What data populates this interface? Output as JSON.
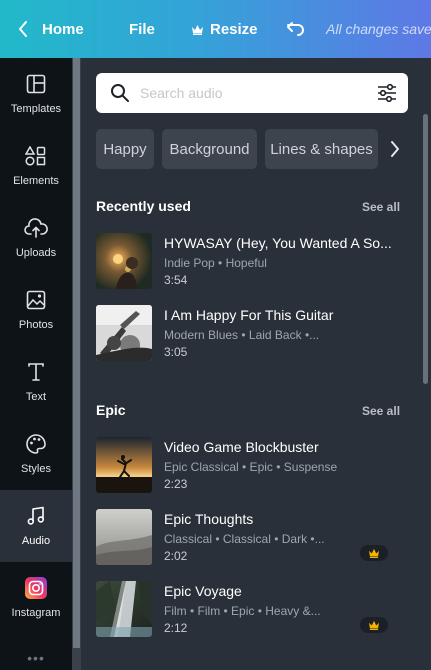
{
  "topbar": {
    "home": "Home",
    "file": "File",
    "resize": "Resize",
    "status": "All changes saved"
  },
  "sidebar": {
    "items": [
      {
        "label": "Templates",
        "icon": "templates-icon"
      },
      {
        "label": "Elements",
        "icon": "elements-icon"
      },
      {
        "label": "Uploads",
        "icon": "upload-cloud-icon"
      },
      {
        "label": "Photos",
        "icon": "photo-icon"
      },
      {
        "label": "Text",
        "icon": "text-icon"
      },
      {
        "label": "Styles",
        "icon": "palette-icon"
      },
      {
        "label": "Audio",
        "icon": "music-note-icon",
        "active": true
      },
      {
        "label": "Instagram",
        "icon": "instagram-icon"
      }
    ],
    "more": "•••"
  },
  "search": {
    "placeholder": "Search audio"
  },
  "chips": [
    "Happy",
    "Background",
    "Lines & shapes"
  ],
  "sections": [
    {
      "title": "Recently used",
      "see_all": "See all",
      "tracks": [
        {
          "title": "HYWASAY (Hey, You Wanted A So...",
          "meta": "Indie Pop • Hopeful",
          "duration": "3:54",
          "premium": false
        },
        {
          "title": "I Am Happy For This Guitar",
          "meta": "Modern Blues • Laid Back •...",
          "duration": "3:05",
          "premium": false
        }
      ]
    },
    {
      "title": "Epic",
      "see_all": "See all",
      "tracks": [
        {
          "title": "Video Game Blockbuster",
          "meta": "Epic Classical • Epic • Suspense",
          "duration": "2:23",
          "premium": false
        },
        {
          "title": "Epic Thoughts",
          "meta": "Classical • Classical • Dark •...",
          "duration": "2:02",
          "premium": true
        },
        {
          "title": "Epic Voyage",
          "meta": "Film • Film • Epic • Heavy &...",
          "duration": "2:12",
          "premium": true
        }
      ]
    }
  ],
  "colors": {
    "panel": "#293039",
    "sidebar": "#0e1318",
    "chip": "#3d444d",
    "crown": "#f5b400"
  }
}
